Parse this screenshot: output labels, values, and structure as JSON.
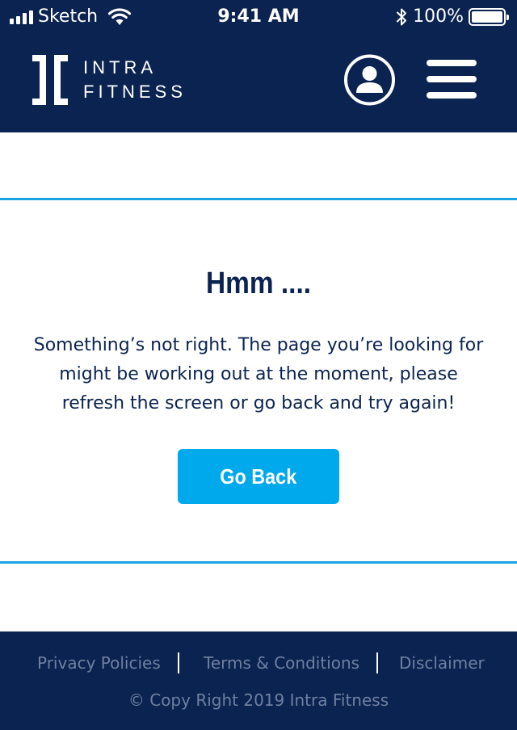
{
  "status_bar": {
    "carrier": "Sketch",
    "time": "9:41 AM",
    "battery": "100%",
    "icons": [
      "signal-icon",
      "wifi-icon",
      "bluetooth-icon",
      "battery-icon"
    ]
  },
  "header": {
    "logo_line1": "INTRA",
    "logo_line2": "FITNESS",
    "icons": [
      "logo-mark-icon",
      "profile-icon",
      "hamburger-menu-icon"
    ]
  },
  "error": {
    "title": "Hmm ....",
    "message": "Something’s not right. The page you’re looking for might be working out at the moment, please refresh the screen or go back and try again!",
    "button_label": "Go Back"
  },
  "footer": {
    "links": [
      "Privacy Policies",
      "Terms & Conditions",
      "Disclaimer"
    ],
    "copyright": "© Copy Right 2019 Intra Fitness"
  },
  "colors": {
    "navy": "#0b2350",
    "accent_blue": "#00a8ec",
    "rule_blue": "#1aa3e3",
    "footer_text": "#6f80a0"
  }
}
